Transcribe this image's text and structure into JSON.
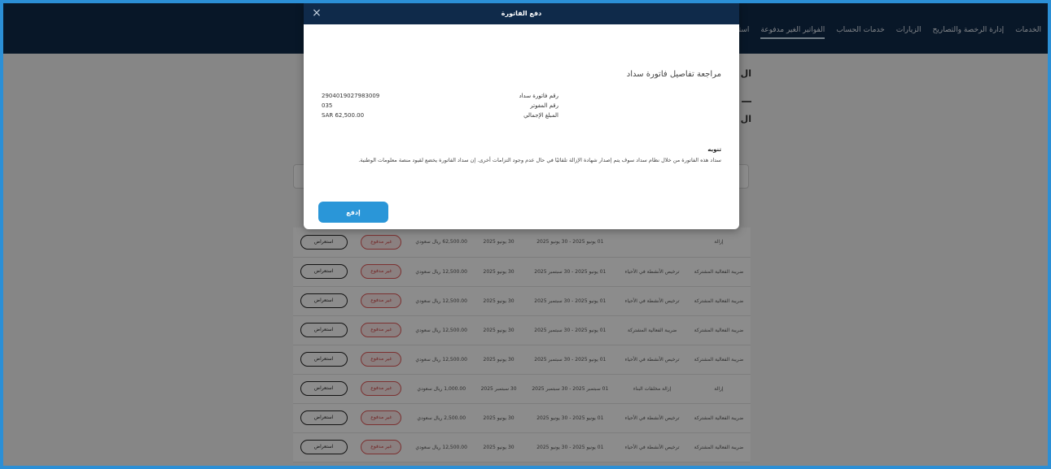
{
  "topnav": {
    "items": [
      {
        "label": "الخدمات"
      },
      {
        "label": "إدارة الرخصة والتصاريح"
      },
      {
        "label": "الزيارات"
      },
      {
        "label": "خدمات الحساب"
      },
      {
        "label": "الفواتير الغير مدفوعة",
        "active": true
      },
      {
        "label": "استيراد الم"
      }
    ]
  },
  "modal": {
    "title": "دفع الفاتورة",
    "subtitle": "مراجعة تفاصيل فاتورة سداد",
    "details": [
      {
        "label": "رقم فاتورة سداد",
        "value": "2904019027983009"
      },
      {
        "label": "رقم المفوتر",
        "value": "035"
      },
      {
        "label": "المبلغ الإجمالي",
        "value": "SAR 62,500.00"
      }
    ],
    "note_title": "تنويه",
    "note_text": "سداد هذه الفاتورة من خلال نظام سداد سوف يتم إصدار شهادة الإزالة تلقائيًا في حال عدم وجود التزامات أخرى. إن سداد الفاتورة يخضع لقيود منصة معلومات الوطنية.",
    "pay_button": "إدفع",
    "close_icon": "×"
  },
  "page": {
    "side_title_1": "ال",
    "side_title_2": "ال"
  },
  "table": {
    "view_label": "استعراض",
    "unpaid_label": "غير مدفوع",
    "rows": [
      {
        "type": "إزالة",
        "desc": "",
        "period": "01 يونيو 2025 - 30 يونيو 2025",
        "due": "30 يونيو 2025",
        "amount": "62,500.00 ريال سعودي"
      },
      {
        "type": "ضريبة الفعالية المشتركة",
        "desc": "ترخيص الأنشطة في الأحياء",
        "period": "01 يونيو 2025 - 30 سبتمبر 2025",
        "due": "30 يونيو 2025",
        "amount": "12,500.00 ريال سعودي"
      },
      {
        "type": "ضريبة الفعالية المشتركة",
        "desc": "ترخيص الأنشطة في الأحياء",
        "period": "01 يونيو 2025 - 30 سبتمبر 2025",
        "due": "30 يونيو 2025",
        "amount": "12,500.00 ريال سعودي"
      },
      {
        "type": "ضريبة الفعالية المشتركة",
        "desc": "ضريبة الفعالية المشتركة",
        "period": "01 يونيو 2025 - 30 سبتمبر 2025",
        "due": "30 يونيو 2025",
        "amount": "12,500.00 ريال سعودي"
      },
      {
        "type": "ضريبة الفعالية المشتركة",
        "desc": "ترخيص الأنشطة في الأحياء",
        "period": "01 يونيو 2025 - 30 سبتمبر 2025",
        "due": "30 يونيو 2025",
        "amount": "12,500.00 ريال سعودي"
      },
      {
        "type": "إزالة",
        "desc": "إزالة مخلفات البناء",
        "period": "01 سبتمبر 2025 - 30 سبتمبر 2025",
        "due": "30 سبتمبر 2025",
        "amount": "1,000.00 ريال سعودي"
      },
      {
        "type": "ضريبة الفعالية المشتركة",
        "desc": "ترخيص الأنشطة في الأحياء",
        "period": "01 يونيو 2025 - 30 يونيو 2025",
        "due": "30 يونيو 2025",
        "amount": "2,500.00 ريال سعودي"
      },
      {
        "type": "ضريبة الفعالية المشتركة",
        "desc": "ترخيص الأنشطة في الأحياء",
        "period": "01 يونيو 2025 - 30 يونيو 2025",
        "due": "30 يونيو 2025",
        "amount": "12,500.00 ريال سعودي"
      }
    ]
  }
}
